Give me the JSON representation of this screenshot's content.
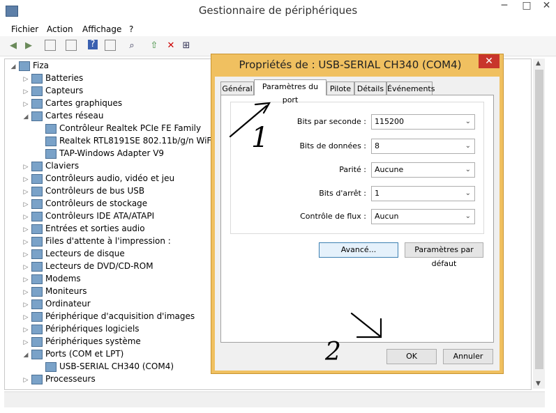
{
  "window": {
    "title": "Gestionnaire de périphériques"
  },
  "menu": [
    "Fichier",
    "Action",
    "Affichage",
    "?"
  ],
  "tree": {
    "root": "Fiza",
    "items": [
      {
        "label": "Batteries",
        "level": 1,
        "exp": "▷"
      },
      {
        "label": "Capteurs",
        "level": 1,
        "exp": "▷"
      },
      {
        "label": "Cartes graphiques",
        "level": 1,
        "exp": "▷"
      },
      {
        "label": "Cartes réseau",
        "level": 1,
        "exp": "◢"
      },
      {
        "label": "Contrôleur Realtek PCIe FE Family",
        "level": 2,
        "exp": ""
      },
      {
        "label": "Realtek RTL8191SE 802.11b/g/n WiFi Adapter",
        "level": 2,
        "exp": ""
      },
      {
        "label": "TAP-Windows Adapter V9",
        "level": 2,
        "exp": ""
      },
      {
        "label": "Claviers",
        "level": 1,
        "exp": "▷"
      },
      {
        "label": "Contrôleurs audio, vidéo et jeu",
        "level": 1,
        "exp": "▷"
      },
      {
        "label": "Contrôleurs de bus USB",
        "level": 1,
        "exp": "▷"
      },
      {
        "label": "Contrôleurs de stockage",
        "level": 1,
        "exp": "▷"
      },
      {
        "label": "Contrôleurs IDE ATA/ATAPI",
        "level": 1,
        "exp": "▷"
      },
      {
        "label": "Entrées et sorties audio",
        "level": 1,
        "exp": "▷"
      },
      {
        "label": "Files d'attente à l'impression :",
        "level": 1,
        "exp": "▷"
      },
      {
        "label": "Lecteurs de disque",
        "level": 1,
        "exp": "▷"
      },
      {
        "label": "Lecteurs de DVD/CD-ROM",
        "level": 1,
        "exp": "▷"
      },
      {
        "label": "Modems",
        "level": 1,
        "exp": "▷"
      },
      {
        "label": "Moniteurs",
        "level": 1,
        "exp": "▷"
      },
      {
        "label": "Ordinateur",
        "level": 1,
        "exp": "▷"
      },
      {
        "label": "Périphérique d'acquisition d'images",
        "level": 1,
        "exp": "▷"
      },
      {
        "label": "Périphériques logiciels",
        "level": 1,
        "exp": "▷"
      },
      {
        "label": "Périphériques système",
        "level": 1,
        "exp": "▷"
      },
      {
        "label": "Ports (COM et LPT)",
        "level": 1,
        "exp": "◢"
      },
      {
        "label": "USB-SERIAL CH340 (COM4)",
        "level": 2,
        "exp": ""
      },
      {
        "label": "Processeurs",
        "level": 1,
        "exp": "▷"
      }
    ]
  },
  "dialog": {
    "title": "Propriétés de : USB-SERIAL CH340 (COM4)",
    "tabs": [
      "Général",
      "Paramètres du port",
      "Pilote",
      "Détails",
      "Événements"
    ],
    "active_tab": "Paramètres du port",
    "fields": [
      {
        "label": "Bits par seconde :",
        "value": "115200"
      },
      {
        "label": "Bits de données :",
        "value": "8"
      },
      {
        "label": "Parité :",
        "value": "Aucune"
      },
      {
        "label": "Bits d'arrêt :",
        "value": "1"
      },
      {
        "label": "Contrôle de flux :",
        "value": "Aucun"
      }
    ],
    "advanced_button": "Avancé...",
    "defaults_button": "Paramètres par défaut",
    "ok_button": "OK",
    "cancel_button": "Annuler",
    "annotations": [
      "1",
      "2"
    ]
  },
  "colors": {
    "dialog_frame": "#f0c060",
    "close_button": "#c8352b"
  }
}
